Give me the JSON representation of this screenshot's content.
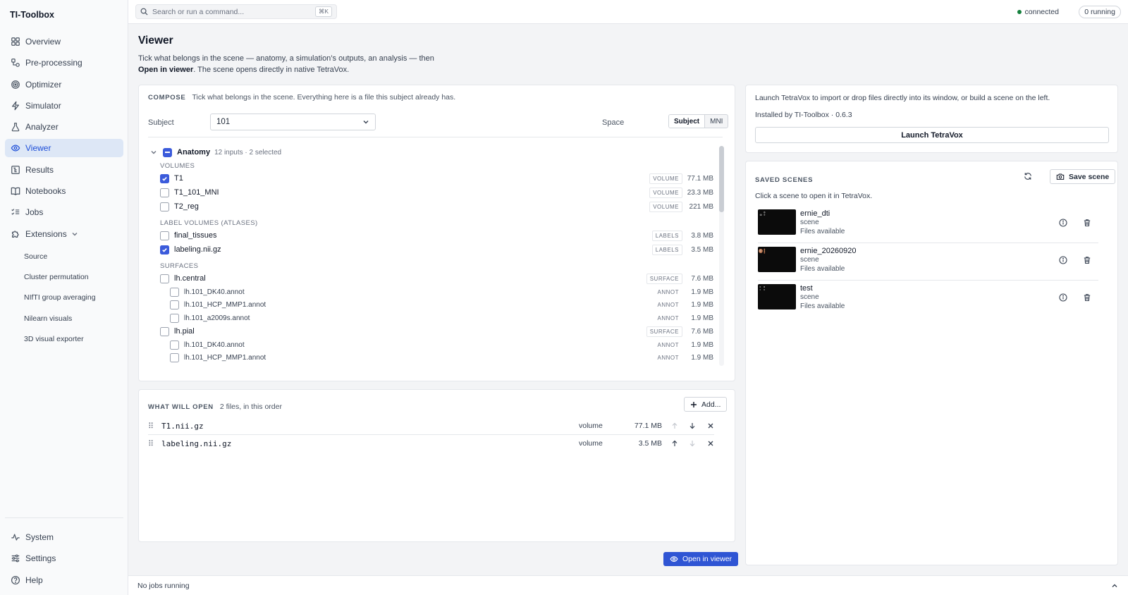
{
  "app": {
    "title": "TI-Toolbox"
  },
  "sidebar": {
    "items": [
      {
        "label": "Overview",
        "icon": "grid-icon",
        "active": false
      },
      {
        "label": "Pre-processing",
        "icon": "workflow-icon",
        "active": false
      },
      {
        "label": "Optimizer",
        "icon": "target-icon",
        "active": false
      },
      {
        "label": "Simulator",
        "icon": "bolt-icon",
        "active": false
      },
      {
        "label": "Analyzer",
        "icon": "flask-icon",
        "active": false
      },
      {
        "label": "Viewer",
        "icon": "eye-icon",
        "active": true
      },
      {
        "label": "Results",
        "icon": "tree-icon",
        "active": false
      },
      {
        "label": "Notebooks",
        "icon": "book-icon",
        "active": false
      },
      {
        "label": "Jobs",
        "icon": "checklist-icon",
        "active": false
      },
      {
        "label": "Extensions",
        "icon": "puzzle-icon",
        "active": false
      }
    ],
    "extensions": [
      "Source",
      "Cluster permutation",
      "NIfTI group averaging",
      "Nilearn visuals",
      "3D visual exporter"
    ],
    "bottom": [
      {
        "label": "System",
        "icon": "activity-icon"
      },
      {
        "label": "Settings",
        "icon": "sliders-icon"
      },
      {
        "label": "Help",
        "icon": "help-icon"
      }
    ]
  },
  "topbar": {
    "search_placeholder": "Search or run a command...",
    "shortcut": "⌘K",
    "status": "connected",
    "running": "0 running"
  },
  "page": {
    "title": "Viewer",
    "desc_line1": "Tick what belongs in the scene — anatomy, a simulation’s outputs, an analysis — then",
    "desc_bold": "Open in viewer",
    "desc_line2": ". The scene opens directly in native TetraVox."
  },
  "compose": {
    "label": "COMPOSE",
    "desc": "Tick what belongs in the scene. Everything here is a file this subject already has.",
    "subject_label": "Subject",
    "subject_value": "101",
    "space_label": "Space",
    "space_options": [
      "Subject",
      "MNI"
    ],
    "space_selected": "Subject",
    "group": {
      "name": "Anatomy",
      "meta": "12 inputs · 2 selected"
    },
    "sections": {
      "volumes": "VOLUMES",
      "labels": "LABEL VOLUMES (ATLASES)",
      "surfaces": "SURFACES"
    },
    "rows": [
      {
        "name": "T1",
        "tag": "VOLUME",
        "size": "77.1 MB",
        "checked": true
      },
      {
        "name": "T1_101_MNI",
        "tag": "VOLUME",
        "size": "23.3 MB",
        "checked": false
      },
      {
        "name": "T2_reg",
        "tag": "VOLUME",
        "size": "221 MB",
        "checked": false
      },
      {
        "name": "final_tissues",
        "tag": "LABELS",
        "size": "3.8 MB",
        "checked": false
      },
      {
        "name": "labeling.nii.gz",
        "tag": "LABELS",
        "size": "3.5 MB",
        "checked": true
      },
      {
        "name": "lh.central",
        "tag": "SURFACE",
        "size": "7.6 MB",
        "checked": false
      },
      {
        "name": "lh.101_DK40.annot",
        "tag": "ANNOT",
        "size": "1.9 MB",
        "checked": false
      },
      {
        "name": "lh.101_HCP_MMP1.annot",
        "tag": "ANNOT",
        "size": "1.9 MB",
        "checked": false
      },
      {
        "name": "lh.101_a2009s.annot",
        "tag": "ANNOT",
        "size": "1.9 MB",
        "checked": false
      },
      {
        "name": "lh.pial",
        "tag": "SURFACE",
        "size": "7.6 MB",
        "checked": false
      },
      {
        "name": "lh.101_DK40.annot",
        "tag": "ANNOT",
        "size": "1.9 MB",
        "checked": false
      },
      {
        "name": "lh.101_HCP_MMP1.annot",
        "tag": "ANNOT",
        "size": "1.9 MB",
        "checked": false
      }
    ]
  },
  "open": {
    "label": "WHAT WILL OPEN",
    "desc": "2 files, in this order",
    "add_label": "Add...",
    "files": [
      {
        "name": "T1.nii.gz",
        "type": "volume",
        "size": "77.1 MB"
      },
      {
        "name": "labeling.nii.gz",
        "type": "volume",
        "size": "3.5 MB"
      }
    ],
    "button_label": "Open in viewer"
  },
  "launch": {
    "desc": "Launch TetraVox to import or drop files directly into its window, or build a scene on the left.",
    "installed": "Installed by TI-Toolbox · 0.6.3",
    "button_label": "Launch TetraVox"
  },
  "scenes": {
    "label": "SAVED SCENES",
    "save_label": "Save scene",
    "desc": "Click a scene to open it in TetraVox.",
    "items": [
      {
        "name": "ernie_dti",
        "type": "scene",
        "status": "Files available"
      },
      {
        "name": "ernie_20260920",
        "type": "scene",
        "status": "Files available"
      },
      {
        "name": "test",
        "type": "scene",
        "status": "Files available"
      }
    ]
  },
  "statusbar": {
    "text": "No jobs running"
  }
}
